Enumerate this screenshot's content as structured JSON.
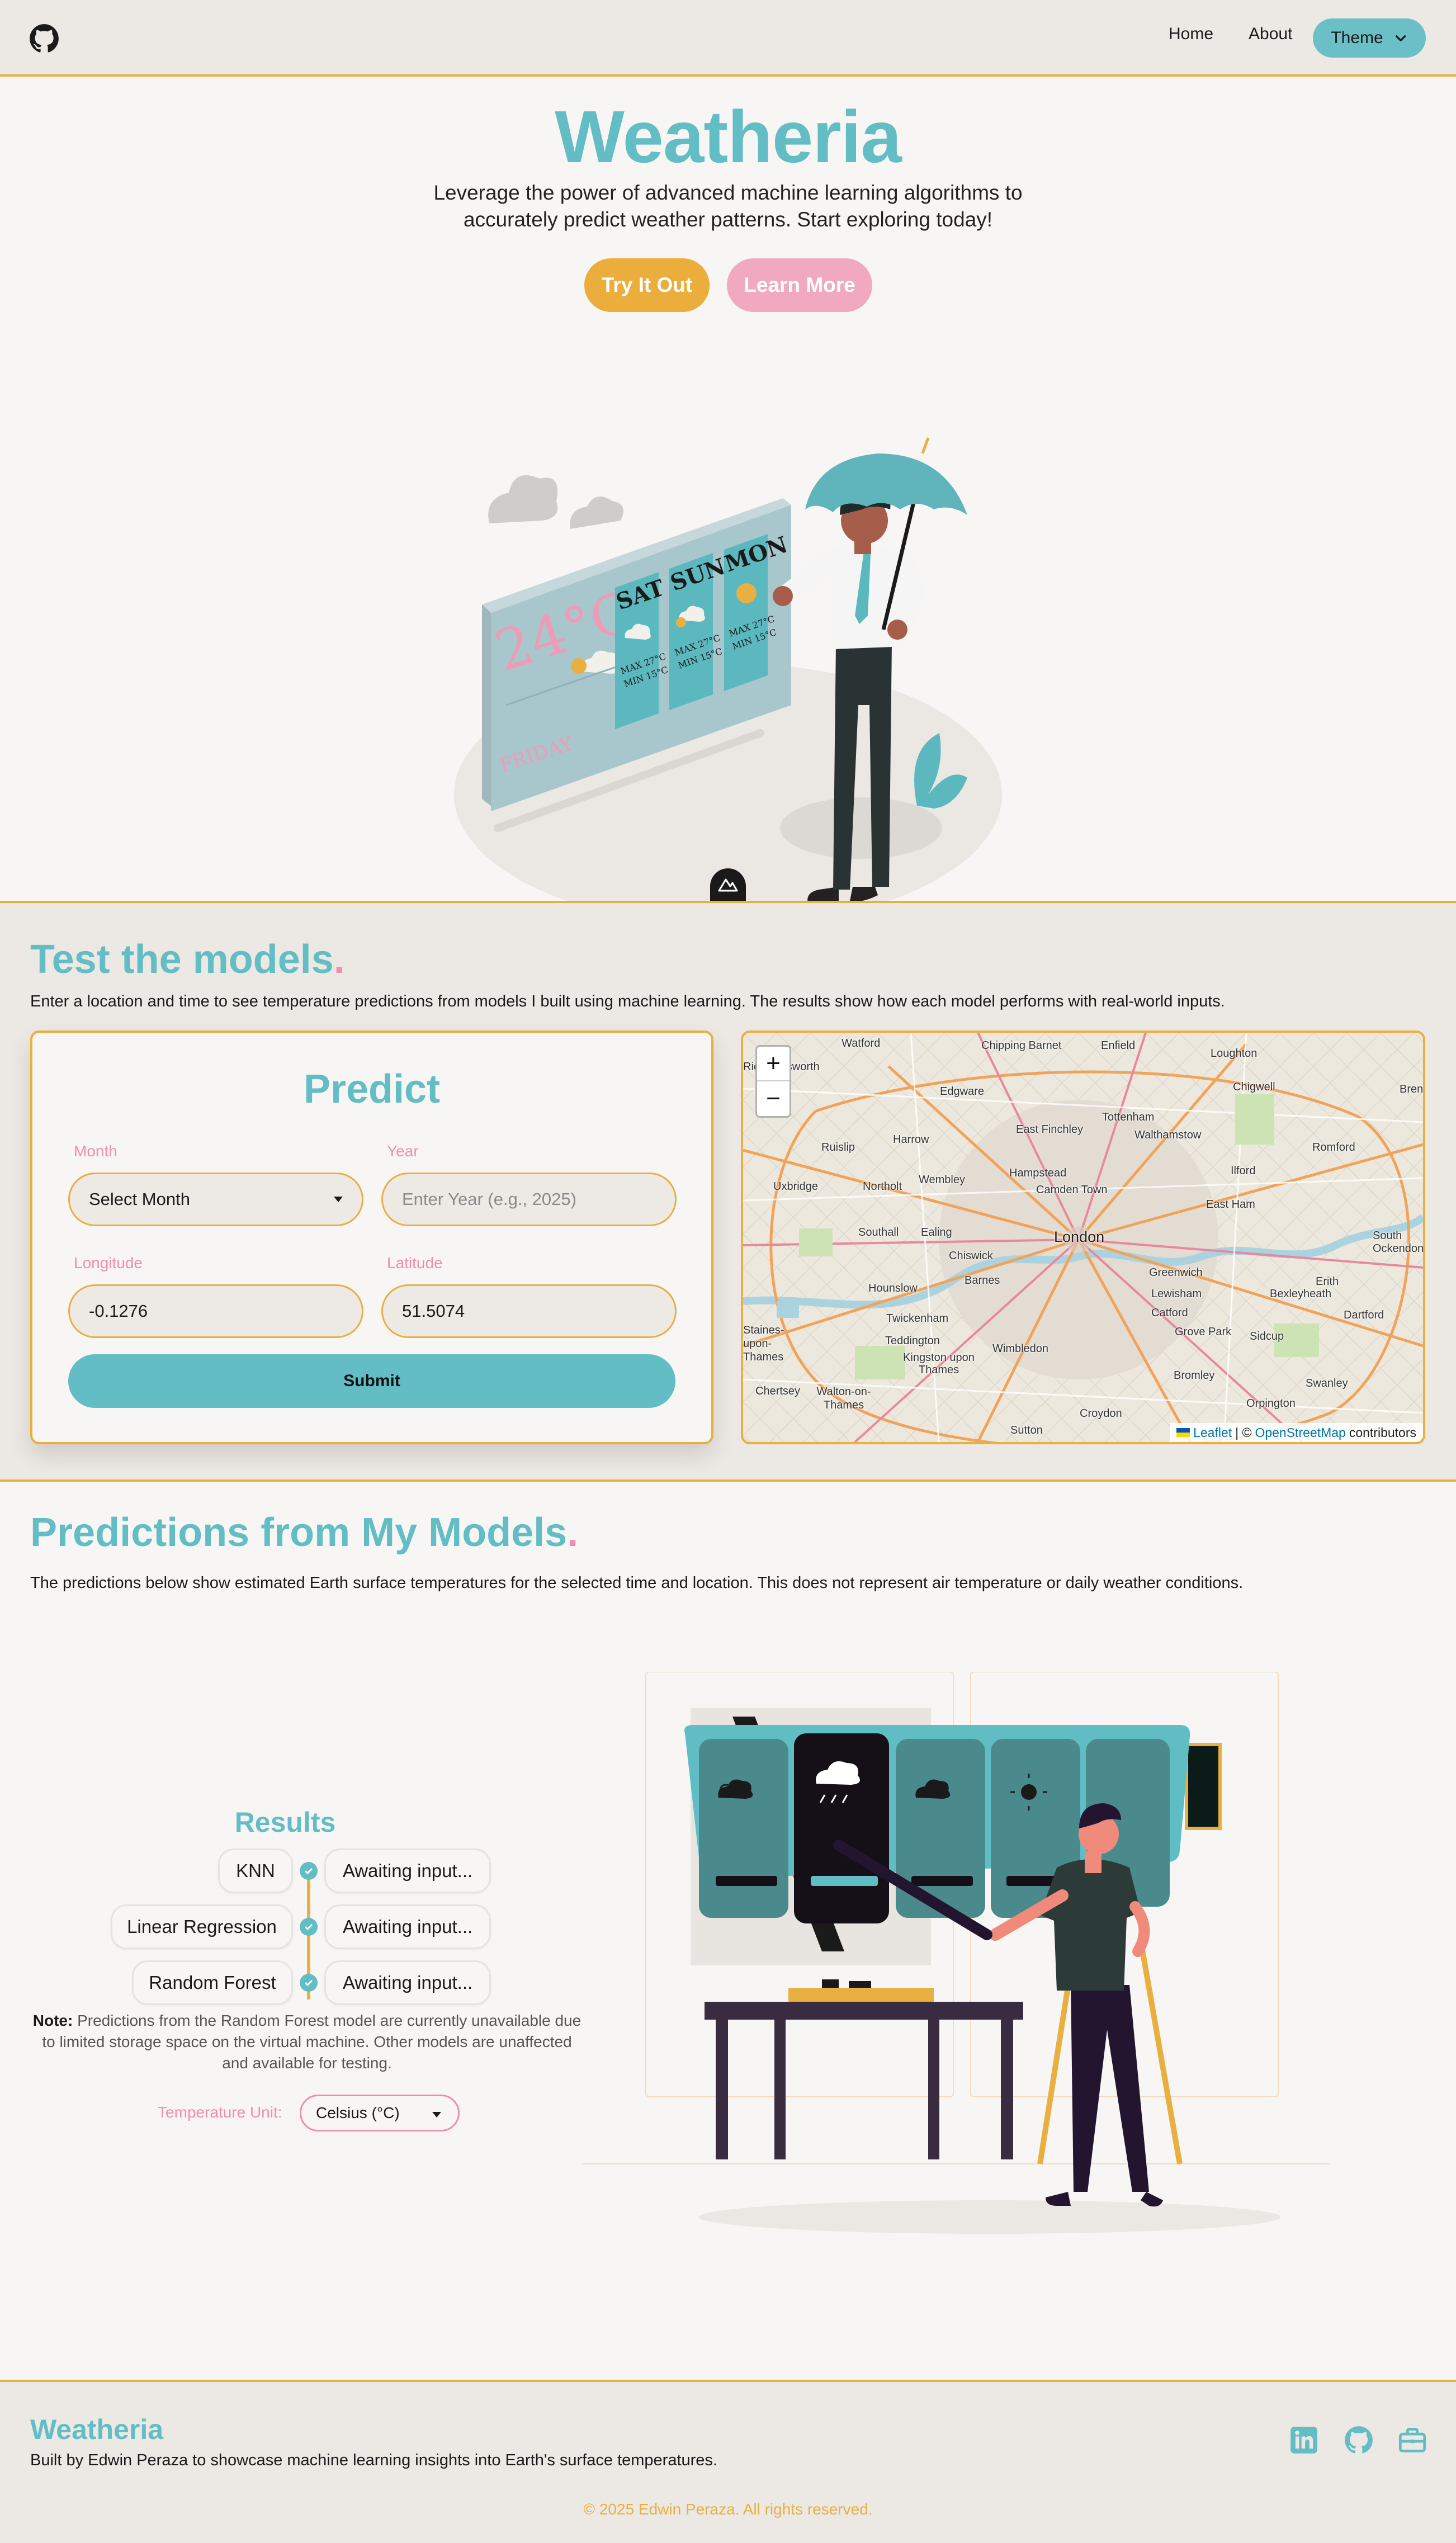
{
  "nav": {
    "home": "Home",
    "about": "About",
    "theme": "Theme"
  },
  "hero": {
    "title": "Weatheria",
    "subtitle_line1": "Leverage the power of advanced machine learning algorithms to",
    "subtitle_line2": "accurately predict weather patterns. Start exploring today!",
    "try_button": "Try It Out",
    "learn_button": "Learn More",
    "board": {
      "today_temp": "24°C",
      "today_day": "FRIDAY",
      "days": [
        {
          "day": "SAT",
          "max": "MAX 27°C",
          "min": "MIN 15°C"
        },
        {
          "day": "SUN",
          "max": "MAX 27°C",
          "min": "MIN 15°C"
        },
        {
          "day": "MON",
          "max": "MAX 27°C",
          "min": "MIN 15°C"
        }
      ]
    }
  },
  "test": {
    "title": "Test the models",
    "title_dot": ".",
    "description": "Enter a location and time to see temperature predictions from models I built using machine learning. The results show how each model performs with real-world inputs.",
    "card_title": "Predict",
    "month_label": "Month",
    "month_value": "Select Month",
    "year_label": "Year",
    "year_placeholder": "Enter Year (e.g., 2025)",
    "longitude_label": "Longitude",
    "longitude_value": "-0.1276",
    "latitude_label": "Latitude",
    "latitude_value": "51.5074",
    "submit": "Submit"
  },
  "map": {
    "zoom_in": "+",
    "zoom_out": "−",
    "places": [
      "Watford",
      "Chipping Barnet",
      "Enfield",
      "Loughton",
      "Chigwell",
      "Edgware",
      "Harrow",
      "East Finchley",
      "Tottenham",
      "Walthamstow",
      "Romford",
      "Ruislip",
      "Wembley",
      "Hampstead",
      "Camden Town",
      "Ilford",
      "Uxbridge",
      "Northolt",
      "East Ham",
      "Southall",
      "Ealing",
      "London",
      "Chiswick",
      "Hounslow",
      "Barnes",
      "Greenwich",
      "Erith",
      "Twickenham",
      "Lewisham",
      "Bexleyheath",
      "Catford",
      "Dartford",
      "Teddington",
      "Wimbledon",
      "Grove Park",
      "Sidcup",
      "Kingston upon Thames",
      "Bromley",
      "Swanley",
      "Chertsey",
      "Walton-on-Thames",
      "Orpington",
      "Croydon",
      "Sutton",
      "Staines-upon-Thames",
      "South Ockendon",
      "Rickmansworth",
      "Brentwood"
    ],
    "attribution_leaflet": "Leaflet",
    "attribution_sep": "| ©",
    "attribution_osm": "OpenStreetMap",
    "attribution_tail": "contributors"
  },
  "predictions": {
    "title": "Predictions from My Models",
    "title_dot": ".",
    "description": "The predictions below show estimated Earth surface temperatures for the selected time and location. This does not represent air temperature or daily weather conditions.",
    "results_title": "Results",
    "models": [
      {
        "name": "KNN",
        "result": "Awaiting input..."
      },
      {
        "name": "Linear Regression",
        "result": "Awaiting input..."
      },
      {
        "name": "Random Forest",
        "result": "Awaiting input..."
      }
    ],
    "note_label": "Note:",
    "note_text": " Predictions from the Random Forest model are currently unavailable due to limited storage space on the virtual machine. Other models are unaffected and available for testing.",
    "unit_label": "Temperature Unit:",
    "unit_value": "Celsius (°C)"
  },
  "footer": {
    "brand": "Weatheria",
    "description": "Built by Edwin Peraza to showcase machine learning insights into Earth's surface temperatures.",
    "copyright": "© 2025 Edwin Peraza. All rights reserved."
  },
  "colors": {
    "teal": "#62bdc4",
    "amber": "#e8b041",
    "pink": "#f08db0",
    "bg": "#f8f6f4",
    "band": "#ece8e4"
  },
  "icons": [
    "github-icon",
    "chevron-down-icon",
    "mountain-icon",
    "linkedin-icon",
    "briefcase-icon",
    "check-icon"
  ]
}
